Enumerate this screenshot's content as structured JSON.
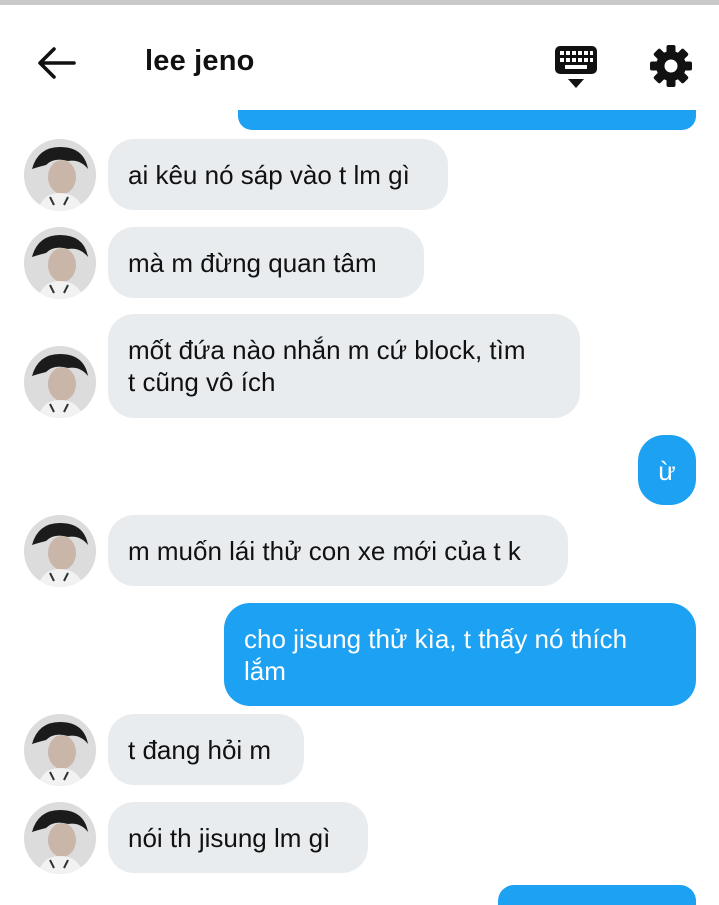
{
  "header": {
    "title": "lee jeno",
    "back_icon": "arrow-left-icon",
    "keyboard_icon": "keyboard-icon",
    "settings_icon": "gear-icon"
  },
  "colors": {
    "sent_bubble": "#1da1f2",
    "received_bubble": "#e9ecef"
  },
  "messages": [
    {
      "from": "them",
      "lines": [
        "ai kêu nó sáp vào t lm gì"
      ]
    },
    {
      "from": "them",
      "lines": [
        "mà m đừng quan tâm"
      ]
    },
    {
      "from": "them",
      "lines": [
        "mốt đứa nào nhắn m cứ block, tìm",
        "t cũng vô ích"
      ]
    },
    {
      "from": "me",
      "lines": [
        "ừ"
      ]
    },
    {
      "from": "them",
      "lines": [
        "m muốn lái thử con xe mới của t k"
      ]
    },
    {
      "from": "me",
      "lines": [
        "cho jisung thử kìa, t thấy nó thích",
        "lắm"
      ]
    },
    {
      "from": "them",
      "lines": [
        "t đang hỏi m"
      ]
    },
    {
      "from": "them",
      "lines": [
        "nói th jisung lm gì"
      ]
    }
  ]
}
